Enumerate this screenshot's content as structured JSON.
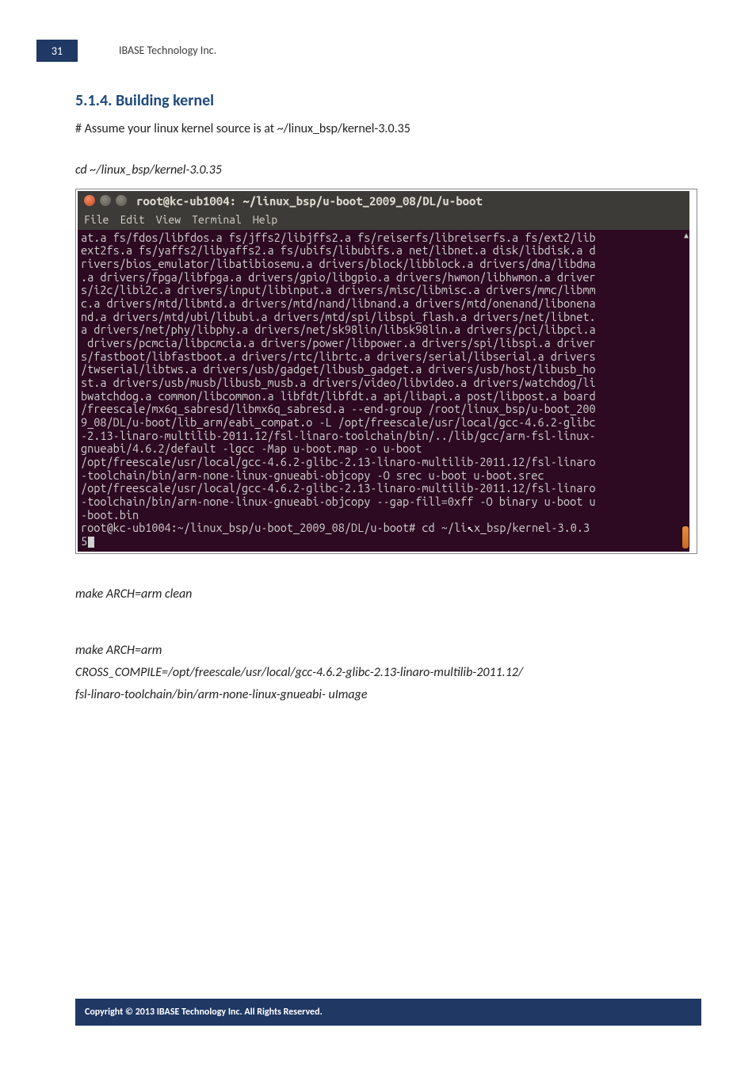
{
  "page_number": "31",
  "company": "IBASE Technology Inc.",
  "section": {
    "heading": "5.1.4. Building kernel",
    "assume_line": "# Assume your linux kernel source is at ~/linux_bsp/kernel-3.0.35",
    "cmd_cd": "cd ~/linux_bsp/kernel-3.0.35",
    "cmd_clean": "make ARCH=arm clean",
    "cmd_make_l1": "make ARCH=arm",
    "cmd_make_l2": "CROSS_COMPILE=/opt/freescale/usr/local/gcc-4.6.2-glibc-2.13-linaro-multilib-2011.12/",
    "cmd_make_l3": "fsl-linaro-toolchain/bin/arm-none-linux-gnueabi- uImage"
  },
  "terminal": {
    "title": "root@kc-ub1004: ~/linux_bsp/u-boot_2009_08/DL/u-boot",
    "menus": {
      "file": "File",
      "edit": "Edit",
      "view": "View",
      "terminal": "Terminal",
      "help": "Help"
    },
    "lines": {
      "l01": "at.a fs/fdos/libfdos.a fs/jffs2/libjffs2.a fs/reiserfs/libreiserfs.a fs/ext2/lib",
      "l02": "ext2fs.a fs/yaffs2/libyaffs2.a fs/ubifs/libubifs.a net/libnet.a disk/libdisk.a d",
      "l03": "rivers/bios_emulator/libatibiosemu.a drivers/block/libblock.a drivers/dma/libdma",
      "l04": ".a drivers/fpga/libfpga.a drivers/gpio/libgpio.a drivers/hwmon/libhwmon.a driver",
      "l05": "s/i2c/libi2c.a drivers/input/libinput.a drivers/misc/libmisc.a drivers/mmc/libmm",
      "l06": "c.a drivers/mtd/libmtd.a drivers/mtd/nand/libnand.a drivers/mtd/onenand/libonena",
      "l07": "nd.a drivers/mtd/ubi/libubi.a drivers/mtd/spi/libspi_flash.a drivers/net/libnet.",
      "l08": "a drivers/net/phy/libphy.a drivers/net/sk98lin/libsk98lin.a drivers/pci/libpci.a",
      "l09": " drivers/pcmcia/libpcmcia.a drivers/power/libpower.a drivers/spi/libspi.a driver",
      "l10": "s/fastboot/libfastboot.a drivers/rtc/librtc.a drivers/serial/libserial.a drivers",
      "l11": "/twserial/libtws.a drivers/usb/gadget/libusb_gadget.a drivers/usb/host/libusb_ho",
      "l12": "st.a drivers/usb/musb/libusb_musb.a drivers/video/libvideo.a drivers/watchdog/li",
      "l13": "bwatchdog.a common/libcommon.a libfdt/libfdt.a api/libapi.a post/libpost.a board",
      "l14": "/freescale/mx6q_sabresd/libmx6q_sabresd.a --end-group /root/linux_bsp/u-boot_200",
      "l15": "9_08/DL/u-boot/lib_arm/eabi_compat.o -L /opt/freescale/usr/local/gcc-4.6.2-glibc",
      "l16": "-2.13-linaro-multilib-2011.12/fsl-linaro-toolchain/bin/../lib/gcc/arm-fsl-linux-",
      "l17": "gnueabi/4.6.2/default -lgcc -Map u-boot.map -o u-boot",
      "l18": "/opt/freescale/usr/local/gcc-4.6.2-glibc-2.13-linaro-multilib-2011.12/fsl-linaro",
      "l19": "-toolchain/bin/arm-none-linux-gnueabi-objcopy -O srec u-boot u-boot.srec",
      "l20": "/opt/freescale/usr/local/gcc-4.6.2-glibc-2.13-linaro-multilib-2011.12/fsl-linaro",
      "l21": "-toolchain/bin/arm-none-linux-gnueabi-objcopy --gap-fill=0xff -O binary u-boot u",
      "l22": "-boot.bin",
      "l23a": "root@kc-ub1004:~/linux_bsp/u-boot_2009_08/DL/u-boot# cd ~/li",
      "l23b": "x_bsp/kernel-3.0.3",
      "l24": "5"
    }
  },
  "footer": "Copyright © 2013 IBASE Technology Inc. All Rights Reserved."
}
